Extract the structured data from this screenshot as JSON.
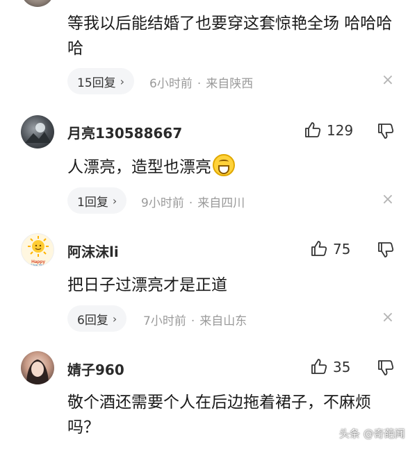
{
  "comments": [
    {
      "text": "等我以后能结婚了也要穿这套惊艳全场 哈哈哈哈",
      "reply_count": "15回复",
      "time": "6小时前",
      "location": "来自陕西"
    },
    {
      "username": "月亮130588667",
      "likes": "129",
      "text": "人漂亮，造型也漂亮",
      "emoji": "grinning-face-emoji",
      "reply_count": "1回复",
      "time": "9小时前",
      "location": "来自四川"
    },
    {
      "username": "阿沫沫li",
      "likes": "75",
      "text": "把日子过漂亮才是正道",
      "reply_count": "6回复",
      "time": "7小时前",
      "location": "来自山东"
    },
    {
      "username": "婧子960",
      "likes": "35",
      "text": "敬个酒还需要个人在后边拖着裙子，不麻烦吗？"
    }
  ],
  "icons": {
    "like": "thumbs-up-icon",
    "dislike": "thumbs-down-icon",
    "reply_chevron": "chevron-right-icon",
    "close": "close-icon"
  },
  "avatar_text": {
    "sun_caption": "Happy New Year"
  },
  "watermark": "头条 @奇葩闻",
  "colors": {
    "meta_gray": "#9a9a9a",
    "pill_bg": "#f4f5f7",
    "text": "#1a1a1a"
  }
}
